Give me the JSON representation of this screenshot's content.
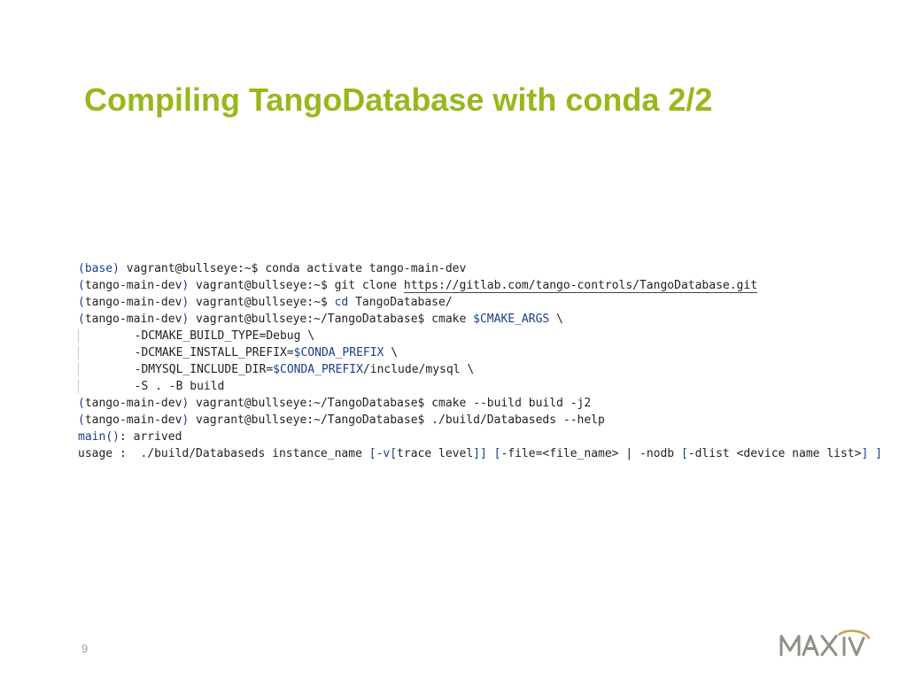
{
  "title": "Compiling TangoDatabase with conda 2/2",
  "page_number": "9",
  "logo_text": "MAX IV",
  "term": {
    "l1": {
      "env_open": "(",
      "env_name": "base",
      "env_close": ")",
      "prompt": " vagrant@bullseye:~$ conda activate tango-main-dev"
    },
    "l2": {
      "env_open": "(",
      "env_close": ")",
      "env_name": "tango-main-dev",
      "prompt": " vagrant@bullseye:~$ git clone ",
      "url": "https://gitlab.com/tango-controls/TangoDatabase.git"
    },
    "l3": {
      "env_open": "(",
      "env_close": ")",
      "env_name": "tango-main-dev",
      "prompt_a": " vagrant@bullseye:~$ ",
      "cd": "cd",
      "prompt_b": " TangoDatabase/"
    },
    "l4": {
      "env_open": "(",
      "env_close": ")",
      "env_name": "tango-main-dev",
      "prompt_a": " vagrant@bullseye:~/TangoDatabase$ cmake ",
      "var": "$CMAKE_ARGS",
      "tail": " \\"
    },
    "l5": {
      "indent": "        ",
      "text": "-DCMAKE_BUILD_TYPE=Debug \\"
    },
    "l6": {
      "indent": "        ",
      "text_a": "-DCMAKE_INSTALL_PREFIX=",
      "var": "$CONDA_PREFIX",
      "text_b": " \\"
    },
    "l7": {
      "indent": "        ",
      "text_a": "-DMYSQL_INCLUDE_DIR=",
      "var": "$CONDA_PREFIX",
      "text_b": "/include/mysql \\"
    },
    "l8": {
      "indent": "        ",
      "text": "-S . -B build"
    },
    "l9": {
      "env_open": "(",
      "env_close": ")",
      "env_name": "tango-main-dev",
      "prompt": " vagrant@bullseye:~/TangoDatabase$ cmake --build build -j2"
    },
    "l10": {
      "env_open": "(",
      "env_close": ")",
      "env_name": "tango-main-dev",
      "prompt": " vagrant@bullseye:~/TangoDatabase$ ./build/Databaseds --help"
    },
    "l11": {
      "main": "main",
      "paren": "()",
      "rest": ": arrived"
    },
    "l12": {
      "a": "usage :  ./build/Databaseds instance_name ",
      "b": "[",
      "c": "-v",
      "d": "[",
      "e": "trace level",
      "f": "]]",
      "g": " ",
      "h": "[",
      "i": "-file=<file_name> | -nodb ",
      "j": "[",
      "k": "-dlist <device name list>",
      "l": "]",
      "m": " ",
      "n": "]"
    }
  }
}
